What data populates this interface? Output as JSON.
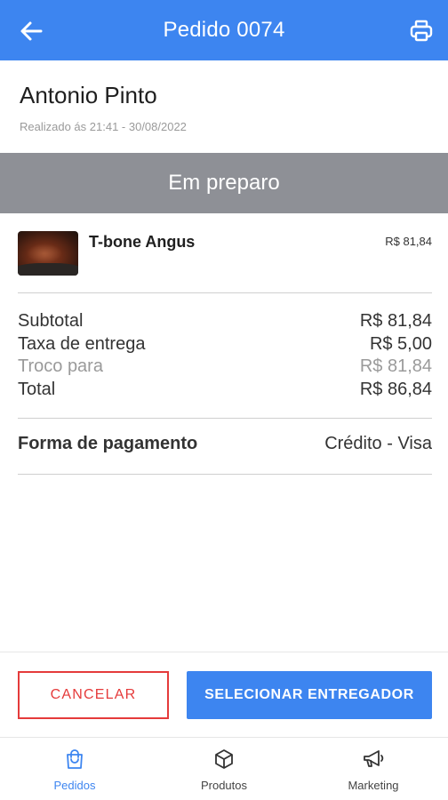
{
  "header": {
    "title": "Pedido 0074",
    "back_icon": "arrow-left-icon",
    "print_icon": "printer-icon",
    "background": "#3d85f0"
  },
  "customer": {
    "name": "Antonio Pinto",
    "placed_at": "Realizado ás 21:41 - 30/08/2022"
  },
  "status": {
    "label": "Em preparo",
    "background": "#8e9096"
  },
  "items": [
    {
      "name": "T-bone Angus",
      "price": "R$ 81,84",
      "image": "steak-photo"
    }
  ],
  "totals": {
    "subtotal_label": "Subtotal",
    "subtotal_value": "R$ 81,84",
    "delivery_label": "Taxa de entrega",
    "delivery_value": "R$ 5,00",
    "change_label": "Troco para",
    "change_value": "R$ 81,84",
    "total_label": "Total",
    "total_value": "R$ 86,84"
  },
  "payment": {
    "label": "Forma de pagamento",
    "value": "Crédito - Visa"
  },
  "actions": {
    "cancel_label": "CANCELAR",
    "select_label": "SELECIONAR ENTREGADOR",
    "cancel_color": "#e53b3b",
    "primary_color": "#3d85f0"
  },
  "nav": {
    "tabs": [
      {
        "label": "Pedidos",
        "icon": "shopping-bag-icon",
        "active": true
      },
      {
        "label": "Produtos",
        "icon": "box-icon",
        "active": false
      },
      {
        "label": "Marketing",
        "icon": "megaphone-icon",
        "active": false
      }
    ]
  }
}
